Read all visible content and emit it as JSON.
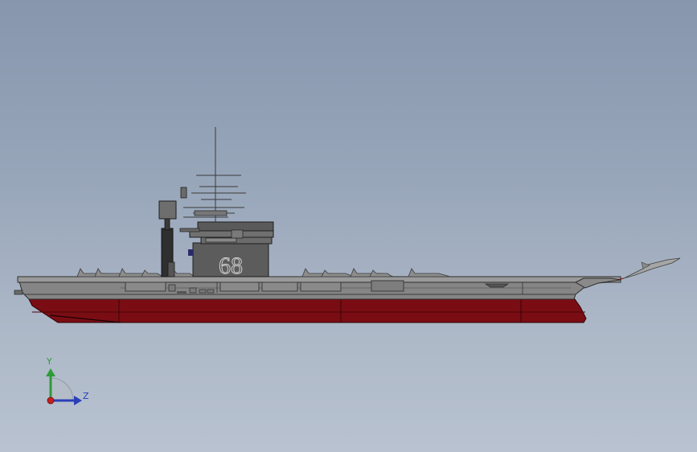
{
  "viewport": {
    "background_top": "#8796ad",
    "background_bottom": "#b8c2d0"
  },
  "ship": {
    "hull_number": "68",
    "hull_color": "#7a0d14",
    "deck_color": "#808080",
    "island_color": "#5a5a5a"
  },
  "triad": {
    "y_label": "Y",
    "z_label": "Z",
    "y_color": "#2f9a3a",
    "z_color": "#2a3fb8",
    "origin_color": "#c81e1e"
  }
}
